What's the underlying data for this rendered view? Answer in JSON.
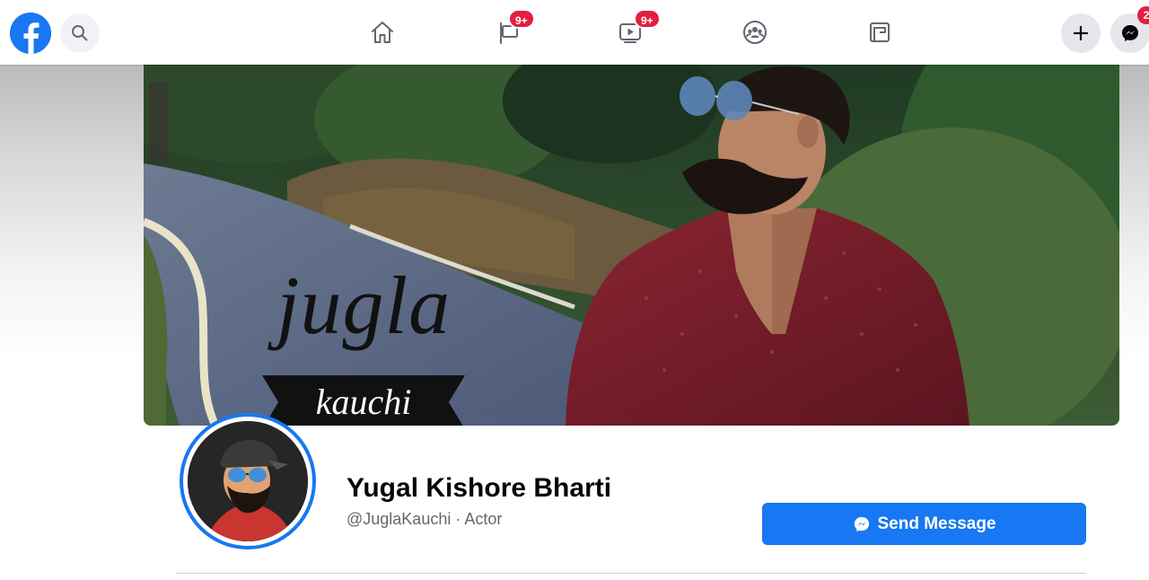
{
  "nav": {
    "badges": {
      "pages": "9+",
      "watch": "9+",
      "messenger": "2"
    },
    "icons": [
      "facebook-logo",
      "search-icon",
      "home-icon",
      "pages-flag-icon",
      "watch-video-icon",
      "groups-icon",
      "gaming-icon",
      "plus-icon",
      "messenger-icon"
    ]
  },
  "cover": {
    "title": "jugla",
    "subtitle": "kauchi"
  },
  "profile": {
    "name": "Yugal Kishore Bharti",
    "handle_category": "@JuglaKauchi · Actor",
    "send_message_label": "Send Message"
  },
  "colors": {
    "brand": "#1877f2",
    "badge": "#e41e3f",
    "text_primary": "#050505",
    "text_secondary": "#65676b"
  }
}
